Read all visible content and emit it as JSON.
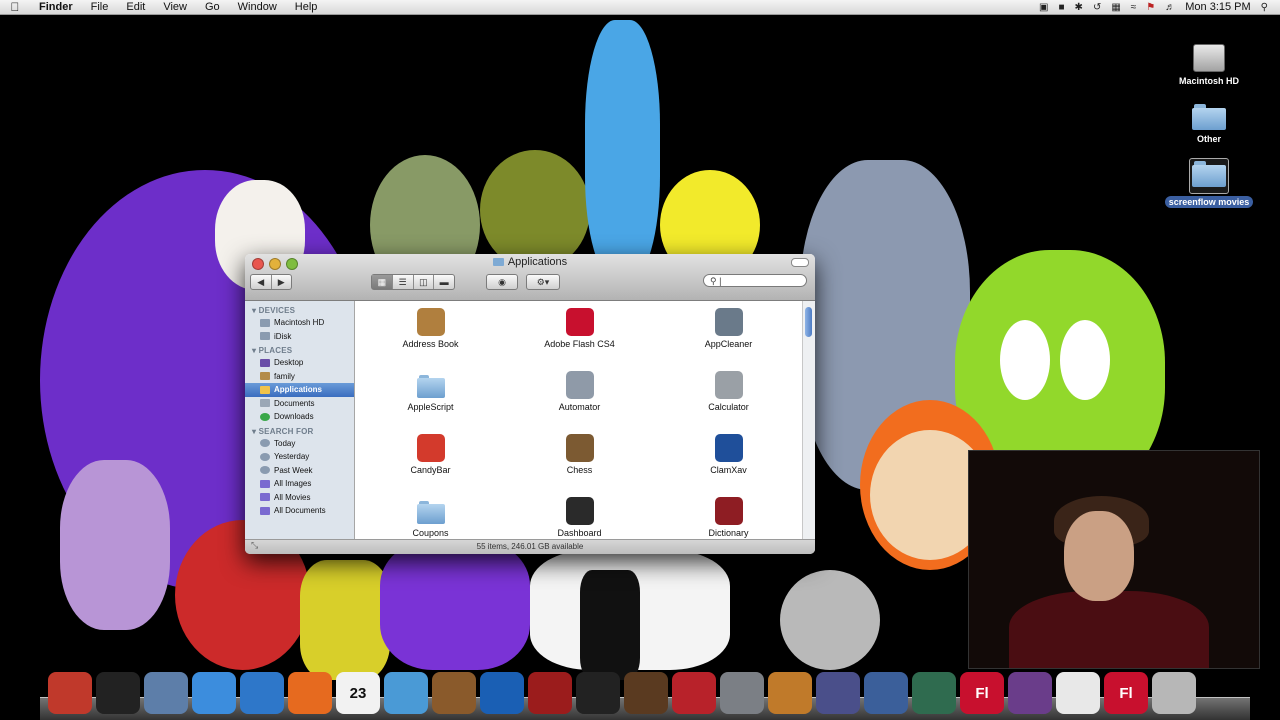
{
  "menubar": {
    "app_name": "Finder",
    "menus": [
      "File",
      "Edit",
      "View",
      "Go",
      "Window",
      "Help"
    ],
    "clock": "Mon 3:15 PM"
  },
  "desktop_icons": [
    {
      "label": "Macintosh HD",
      "icon": "hard-drive-icon"
    },
    {
      "label": "Other",
      "icon": "folder-icon"
    },
    {
      "label": "screenflow movies",
      "icon": "folder-icon"
    }
  ],
  "finder": {
    "title": "Applications",
    "search_placeholder": "",
    "sidebar": {
      "devices_header": "DEVICES",
      "devices": [
        "Macintosh HD",
        "iDisk"
      ],
      "places_header": "PLACES",
      "places": [
        "Desktop",
        "family",
        "Applications",
        "Documents",
        "Downloads"
      ],
      "selected": "Applications",
      "search_header": "SEARCH FOR",
      "searches": [
        "Today",
        "Yesterday",
        "Past Week",
        "All Images",
        "All Movies",
        "All Documents"
      ]
    },
    "items": [
      {
        "label": "Address Book",
        "icon": "address-book-icon",
        "color": "#b07f3e"
      },
      {
        "label": "Adobe Flash CS4",
        "icon": "adobe-flash-folder-icon",
        "color": "#c8102e"
      },
      {
        "label": "AppCleaner",
        "icon": "trash-can-icon",
        "color": "#6a7a8a"
      },
      {
        "label": "AppleScript",
        "icon": "folder-icon",
        "color": "#7eaad4"
      },
      {
        "label": "Automator",
        "icon": "automator-robot-icon",
        "color": "#8f9aa8"
      },
      {
        "label": "Calculator",
        "icon": "calculator-icon",
        "color": "#9aa0a6"
      },
      {
        "label": "CandyBar",
        "icon": "candybar-icon",
        "color": "#d33a2c"
      },
      {
        "label": "Chess",
        "icon": "chess-knight-icon",
        "color": "#7c5a32"
      },
      {
        "label": "ClamXav",
        "icon": "clamxav-icon",
        "color": "#1f4f9a"
      },
      {
        "label": "Coupons",
        "icon": "folder-icon",
        "color": "#7eaad4"
      },
      {
        "label": "Dashboard",
        "icon": "dashboard-gauge-icon",
        "color": "#2a2a2a"
      },
      {
        "label": "Dictionary",
        "icon": "dictionary-book-icon",
        "color": "#8e1d23"
      }
    ],
    "status": "55 items, 246.01 GB available"
  },
  "dock": {
    "items": [
      {
        "name": "finder-icon",
        "color": "#c0392b"
      },
      {
        "name": "dashboard-icon",
        "color": "#222222"
      },
      {
        "name": "mail-icon",
        "color": "#5d7ea9"
      },
      {
        "name": "ichat-icon",
        "color": "#3c8ddd"
      },
      {
        "name": "safari-icon",
        "color": "#2e77c9"
      },
      {
        "name": "firefox-icon",
        "color": "#e66a1f"
      },
      {
        "name": "ical-icon",
        "color": "#f2f2f2",
        "text": "23"
      },
      {
        "name": "itunes-icon",
        "color": "#4a9ad6"
      },
      {
        "name": "iphoto-icon",
        "color": "#8a5a2b"
      },
      {
        "name": "dvd-player-icon",
        "color": "#1a5fb4"
      },
      {
        "name": "photo-booth-icon",
        "color": "#9b1c1c"
      },
      {
        "name": "imovie-icon",
        "color": "#222222"
      },
      {
        "name": "keynote-icon",
        "color": "#5a3a20"
      },
      {
        "name": "chair-app-icon",
        "color": "#b8222a"
      },
      {
        "name": "system-preferences-icon",
        "color": "#7b7f85"
      },
      {
        "name": "garageband-icon",
        "color": "#c07a2a"
      },
      {
        "name": "pen-app-icon",
        "color": "#4a4f8a"
      },
      {
        "name": "expose-spaces-icon",
        "color": "#3b5f9a"
      },
      {
        "name": "time-machine-icon",
        "color": "#2f6b4f"
      },
      {
        "name": "flash-icon",
        "color": "#c8102e",
        "text": "Fl"
      },
      {
        "name": "imovie-clapper-icon",
        "color": "#6a3d8a"
      },
      {
        "name": "mp3-file-icon",
        "color": "#e8e8e8"
      },
      {
        "name": "fla-file-icon",
        "color": "#c8102e",
        "text": "Fl"
      },
      {
        "name": "trash-icon",
        "color": "#b7b7b7"
      }
    ]
  }
}
